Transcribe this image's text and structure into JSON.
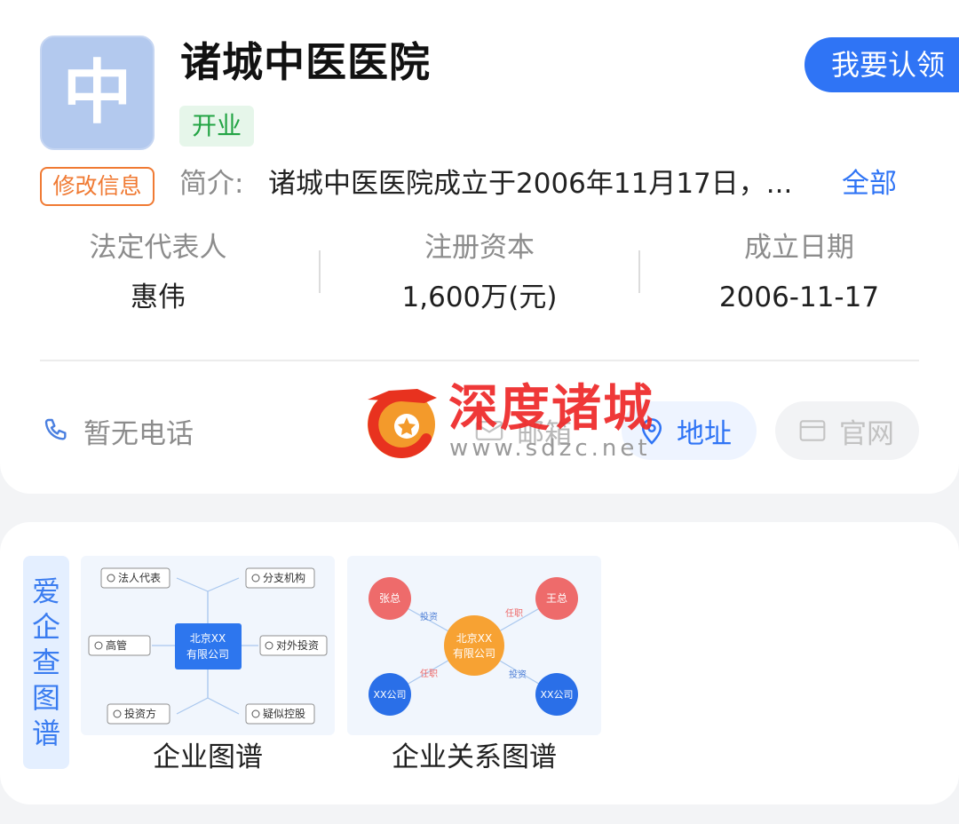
{
  "company": {
    "logo_char": "中",
    "name": "诸城中医医院",
    "status": "开业",
    "claim_label": "我要认领",
    "edit_label": "修改信息",
    "intro_label": "简介:",
    "intro_text": "诸城中医医院成立于2006年11月17日，...",
    "intro_all": "全部"
  },
  "stats": [
    {
      "label": "法定代表人",
      "value": "惠伟"
    },
    {
      "label": "注册资本",
      "value": "1,600万(元)"
    },
    {
      "label": "成立日期",
      "value": "2006-11-17"
    }
  ],
  "contacts": {
    "phone": "暂无电话",
    "email": "邮箱",
    "address": "地址",
    "website": "官网"
  },
  "watermark": {
    "text": "深度诸城",
    "url": "www.sdzc.net"
  },
  "graph": {
    "side_tab": [
      "爱",
      "企",
      "查",
      "图",
      "谱"
    ],
    "items": [
      {
        "caption": "企业图谱",
        "center": [
          "北京XX",
          "有限公司"
        ],
        "nodes": [
          "法人代表",
          "分支机构",
          "高管",
          "对外投资",
          "投资方",
          "疑似控股"
        ]
      },
      {
        "caption": "企业关系图谱",
        "center": [
          "北京XX",
          "有限公司"
        ],
        "nodes": [
          "张总",
          "王总",
          "XX公司",
          "XX公司"
        ],
        "edges": [
          "投资",
          "任职",
          "任职",
          "投资"
        ]
      }
    ]
  },
  "colors": {
    "accent": "#2f74f5",
    "status_green": "#22a444",
    "edit_orange": "#f07a33",
    "watermark_red": "#ee2a2a",
    "node_red": "#ee6b6b",
    "node_blue": "#2a6fe8",
    "node_orange": "#f7a233"
  }
}
